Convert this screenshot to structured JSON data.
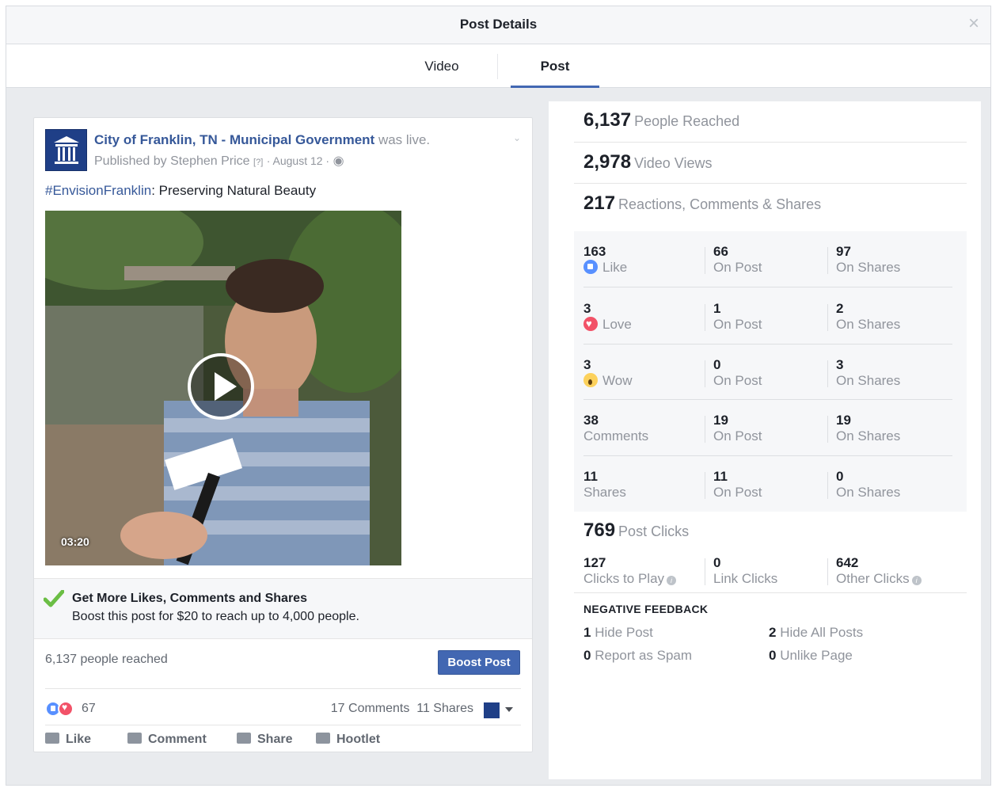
{
  "modal": {
    "title": "Post Details",
    "close": "×"
  },
  "tabs": [
    {
      "label": "Video"
    },
    {
      "label": "Post"
    }
  ],
  "post": {
    "page_name": "City of Franklin, TN - Municipal Government",
    "was_live": "was live.",
    "published_by": "Published by Stephen Price",
    "help_marker": "[?]",
    "date": "· August 12 ·",
    "privacy_icon": "globe-icon",
    "hashtag": "#EnvisionFranklin",
    "text_rest": ": Preserving Natural Beauty",
    "video_duration": "03:20",
    "boost_title": "Get More Likes, Comments and Shares",
    "boost_sub": "Boost this post for $20 to reach up to 4,000 people.",
    "people_reached": "6,137 people reached",
    "boost_button": "Boost Post",
    "reaction_count": "67",
    "comments": "17 Comments",
    "shares": "11 Shares",
    "actions": {
      "like": "Like",
      "comment": "Comment",
      "share": "Share",
      "hootlet": "Hootlet"
    }
  },
  "stats": {
    "reached": {
      "value": "6,137",
      "label": "People Reached"
    },
    "views": {
      "value": "2,978",
      "label": "Video Views"
    },
    "engagement": {
      "value": "217",
      "label": "Reactions, Comments & Shares"
    },
    "rows": [
      {
        "total": "163",
        "label": "Like",
        "on_post": "66",
        "on_shares": "97"
      },
      {
        "total": "3",
        "label": "Love",
        "on_post": "1",
        "on_shares": "2"
      },
      {
        "total": "3",
        "label": "Wow",
        "on_post": "0",
        "on_shares": "3"
      },
      {
        "total": "38",
        "label": "Comments",
        "on_post": "19",
        "on_shares": "19"
      },
      {
        "total": "11",
        "label": "Shares",
        "on_post": "11",
        "on_shares": "0"
      }
    ],
    "on_post_label": "On Post",
    "on_shares_label": "On Shares",
    "clicks": {
      "value": "769",
      "label": "Post Clicks"
    },
    "click_breakdown": [
      {
        "value": "127",
        "label": "Clicks to Play"
      },
      {
        "value": "0",
        "label": "Link Clicks"
      },
      {
        "value": "642",
        "label": "Other Clicks"
      }
    ],
    "negative_title": "NEGATIVE FEEDBACK",
    "negative": [
      {
        "value": "1",
        "label": "Hide Post"
      },
      {
        "value": "2",
        "label": "Hide All Posts"
      },
      {
        "value": "0",
        "label": "Report as Spam"
      },
      {
        "value": "0",
        "label": "Unlike Page"
      }
    ]
  },
  "colors": {
    "brand_blue": "#4267b2",
    "link": "#365899",
    "secondary_text": "#90949c"
  }
}
